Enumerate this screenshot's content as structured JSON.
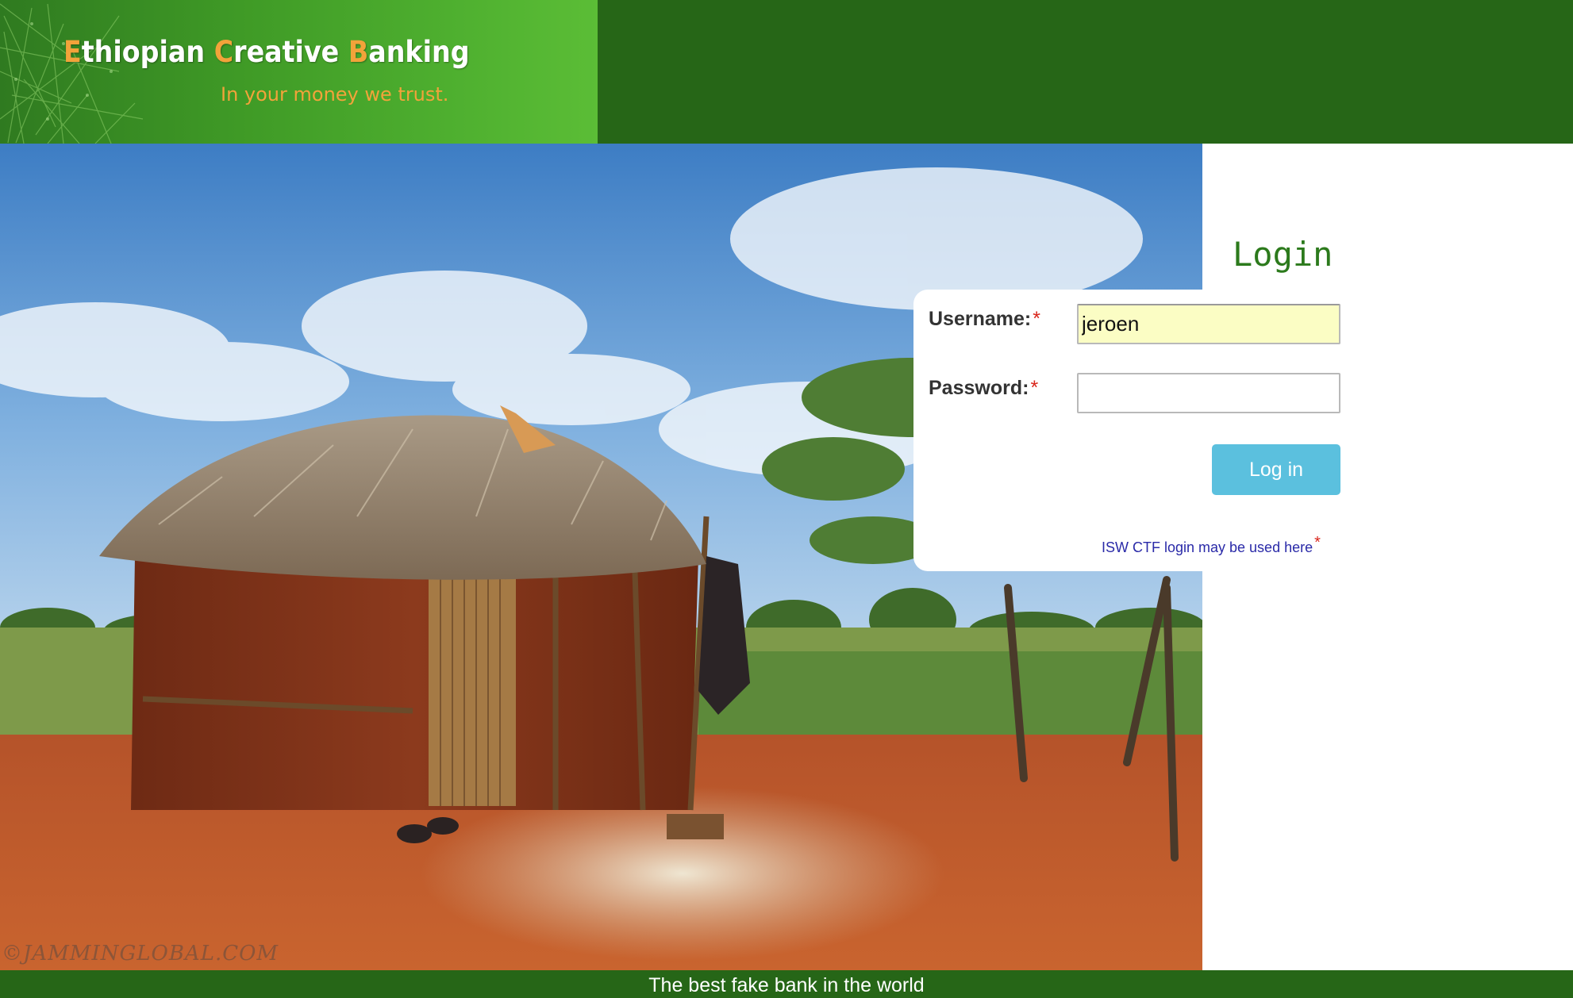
{
  "header": {
    "logo": {
      "word1_initial": "E",
      "word1_rest": "thiopian",
      "word2_initial": "C",
      "word2_rest": "reative",
      "word3_initial": "B",
      "word3_rest": "anking"
    },
    "tagline": "In your money we trust."
  },
  "hero": {
    "watermark": "©JAMMINGLOBAL.COM"
  },
  "login": {
    "title": "Login",
    "username_label": "Username:",
    "username_value": "jeroen",
    "password_label": "Password:",
    "password_value": "",
    "required_marker": "*",
    "submit_label": "Log in",
    "alt_login_link": "ISW CTF login may be used here"
  },
  "footer": {
    "text": "The best fake bank in the world"
  },
  "colors": {
    "header_green": "#266617",
    "banner_green": "#5bbd36",
    "logo_accent": "#f2a33a",
    "title_green": "#2c7a1c",
    "button_blue": "#5bc0de",
    "autofill_yellow": "#fbfdc4",
    "required_red": "#d9261c",
    "link_blue": "#2a2aa8"
  }
}
